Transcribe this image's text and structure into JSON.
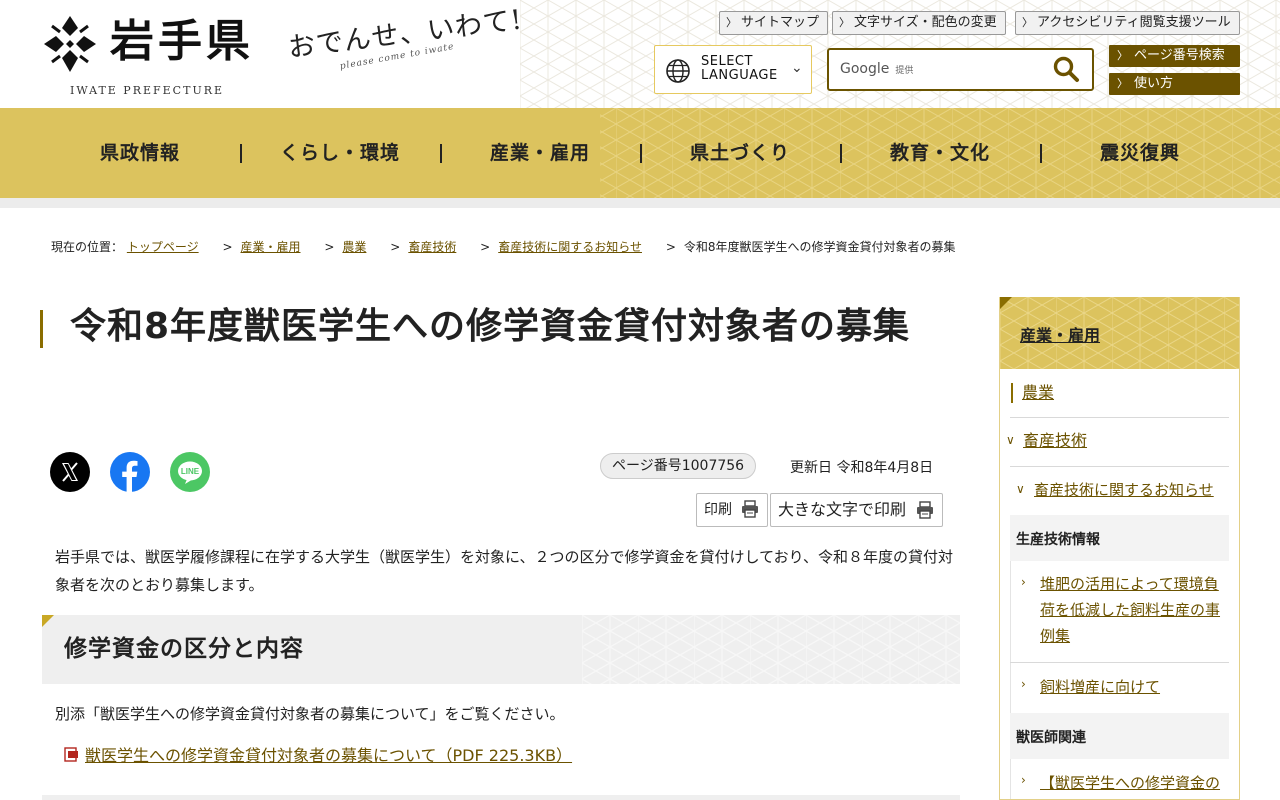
{
  "header": {
    "logo_name": "岩手県",
    "logo_en": "IWATE PREFECTURE",
    "slogan": "おでんせ、いわて!",
    "slogan_sub": "please come to iwate",
    "util_links": {
      "sitemap": "サイトマップ",
      "font_color": "文字サイズ・配色の変更",
      "accessibility": "アクセシビリティ閲覧支援ツール"
    },
    "language": {
      "line1": "SELECT",
      "line2": "LANGUAGE"
    },
    "search": {
      "google": "Google",
      "provided": "提供",
      "value": ""
    },
    "page_number_search": "ページ番号検索",
    "how_to_use": "使い方"
  },
  "nav": {
    "items": [
      "県政情報",
      "くらし・環境",
      "産業・雇用",
      "県土づくり",
      "教育・文化",
      "震災復興"
    ]
  },
  "breadcrumb": {
    "label": "現在の位置：",
    "items": [
      "トップページ",
      "産業・雇用",
      "農業",
      "畜産技術",
      "畜産技術に関するお知らせ"
    ],
    "current": "令和8年度獣医学生への修学資金貸付対象者の募集"
  },
  "main": {
    "title": "令和8年度獣医学生への修学資金貸付対象者の募集",
    "page_number": "ページ番号1007756",
    "updated": "更新日 令和8年4月8日",
    "print": "印刷",
    "print_large": "大きな文字で印刷",
    "intro": "岩手県では、獣医学履修課程に在学する大学生（獣医学生）を対象に、２つの区分で修学資金を貸付けしており、令和８年度の貸付対象者を次のとおり募集します。",
    "section_title": "修学資金の区分と内容",
    "section_note": "別添「獣医学生への修学資金貸付対象者の募集について」をご覧ください。",
    "pdf_link": "獣医学生への修学資金貸付対象者の募集について（PDF 225.3KB）"
  },
  "sidebar": {
    "header": "産業・雇用",
    "level1": "農業",
    "level2": "畜産技術",
    "level3": "畜産技術に関するお知らせ",
    "group1_label": "生産技術情報",
    "group1_links": [
      "堆肥の活用によって環境負荷を低減した飼料生産の事例集",
      "飼料増産に向けて"
    ],
    "group2_label": "獣医師関連",
    "group2_links": [
      "【獣医学生への修学資金の"
    ]
  },
  "colors": {
    "gold": "#dcc35e",
    "brown": "#6b5200",
    "x_brand": "#000000",
    "facebook": "#1877f2",
    "line": "#4cc764"
  }
}
